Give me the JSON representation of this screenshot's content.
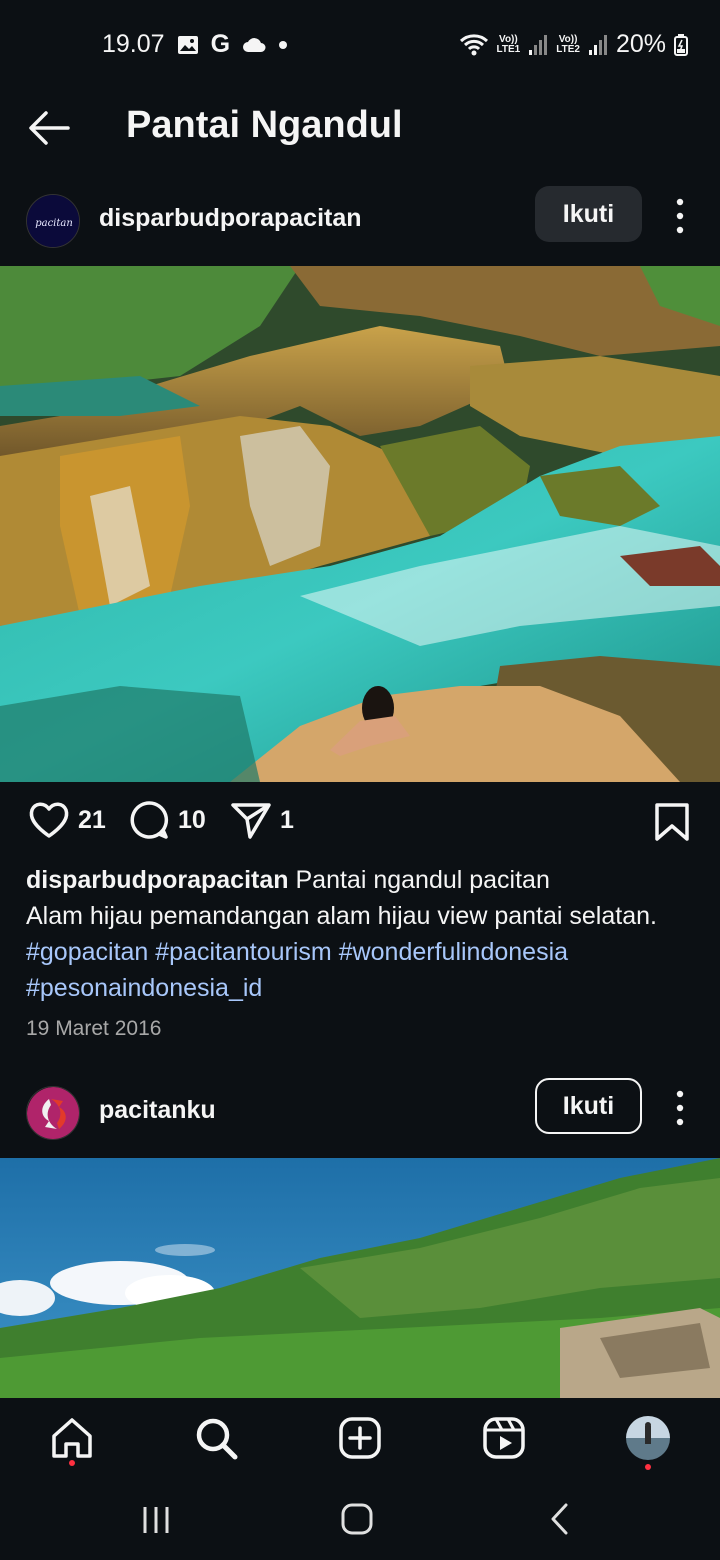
{
  "status_bar": {
    "time": "19.07",
    "g_label": "G",
    "lte1_top": "Vo))",
    "lte1_bottom": "LTE1",
    "lte2_top": "Vo))",
    "lte2_bottom": "LTE2",
    "battery": "20%"
  },
  "header": {
    "title": "Pantai Ngandul"
  },
  "post1": {
    "username": "disparbudporapacitan",
    "avatar_text": "pacitan",
    "follow_label": "Ikuti",
    "likes": "21",
    "comments": "10",
    "shares": "1",
    "caption_user": "disparbudporapacitan",
    "caption_line1": " Pantai ngandul pacitan",
    "caption_line2": "Alam hijau pemandangan alam hijau view pantai selatan.",
    "hashtags_line1": "#gopacitan #pacitantourism #wonderfulindonesia",
    "hashtags_line2": "#pesonaindonesia_id",
    "date": "19 Maret 2016"
  },
  "post2": {
    "username": "pacitanku",
    "follow_label": "Ikuti"
  },
  "colors": {
    "background": "#0c1014",
    "hashtag": "#a8c7fa",
    "notification_dot": "#ff3040"
  }
}
